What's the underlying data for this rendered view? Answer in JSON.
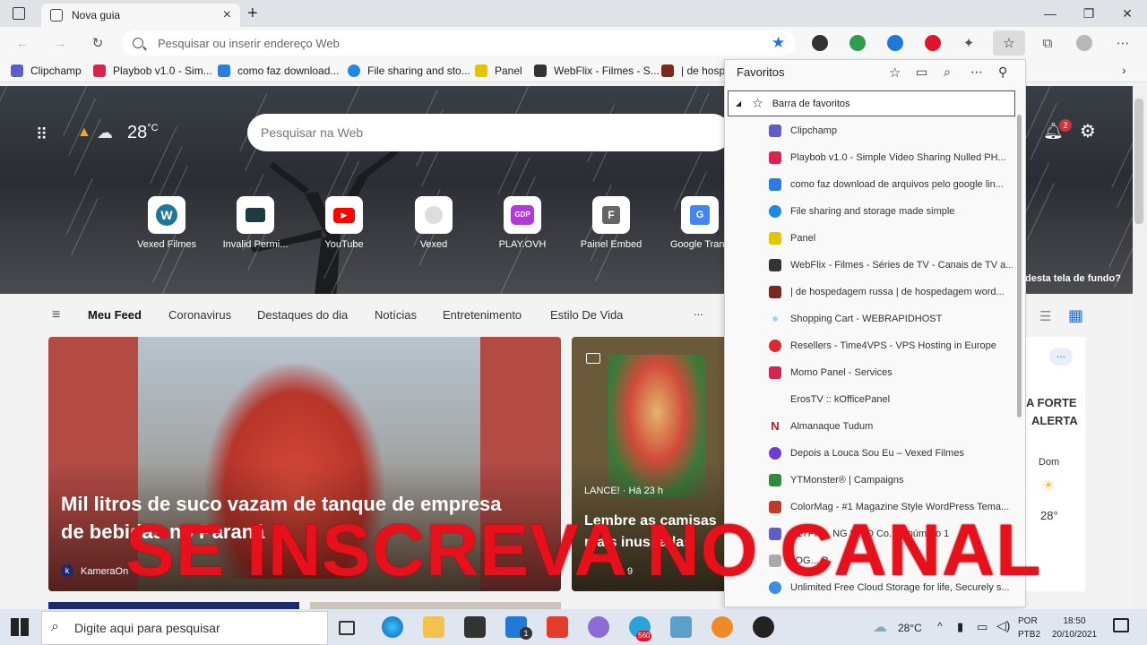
{
  "tab": {
    "title": "Nova guia"
  },
  "address": {
    "placeholder": "Pesquisar ou inserir endereço Web"
  },
  "bookmarks": [
    {
      "label": "Clipchamp",
      "color": "#5b5fc7"
    },
    {
      "label": "Playbob v1.0 - Sim...",
      "color": "#d6244c"
    },
    {
      "label": "como faz download...",
      "color": "#2a7de1"
    },
    {
      "label": "File sharing and sto...",
      "color": "#1e88e5"
    },
    {
      "label": "Panel",
      "color": "#e6c200"
    },
    {
      "label": "WebFlix - Filmes - S...",
      "color": "#333333"
    },
    {
      "label": "| de hospe",
      "color": "#7a2a1a"
    }
  ],
  "weather": {
    "temp": "28",
    "unit": "°C"
  },
  "websearch": {
    "placeholder": "Pesquisar na Web"
  },
  "notifications": {
    "count": "2"
  },
  "quicklinks": [
    {
      "label": "Vexed Filmes",
      "icon": "wordpress-icon"
    },
    {
      "label": "Invalid Permi...",
      "icon": "panel-icon"
    },
    {
      "label": "YouTube",
      "icon": "youtube-icon"
    },
    {
      "label": "Vexed",
      "icon": "circle-icon"
    },
    {
      "label": "PLAY.OVH",
      "icon": "gdp-icon"
    },
    {
      "label": "Painel Embed",
      "icon": "f-icon"
    },
    {
      "label": "Google Trans",
      "icon": "translate-icon"
    }
  ],
  "hero_question": "desta tela de fundo?",
  "feednav": {
    "items": [
      "Meu Feed",
      "Coronavirus",
      "Destaques do dia",
      "Notícias",
      "Entretenimento",
      "Estilo De Vida"
    ],
    "more": "..."
  },
  "card1": {
    "headline": "Mil litros de suco vazam de tanque de empresa de bebidas no Paraná",
    "source": "KameraOn"
  },
  "card2": {
    "source": "LANCE! · Há 23 h",
    "headline": "Lembre as camisas mais inusitadas",
    "count": "9"
  },
  "card3": {
    "line1": "A FORTE",
    "line2": "ALERTA",
    "day": "Dom",
    "temp": "28°",
    "more": "..."
  },
  "favorites": {
    "title": "Favoritos",
    "folder": "Barra de favoritos",
    "items": [
      {
        "label": "Clipchamp",
        "color": "#5b5fc7"
      },
      {
        "label": "Playbob v1.0 - Simple Video Sharing Nulled PH...",
        "color": "#d6244c"
      },
      {
        "label": "como faz download de arquivos pelo google lin...",
        "color": "#2a7de1"
      },
      {
        "label": "File sharing and storage made simple",
        "color": "#1e88e5"
      },
      {
        "label": "Panel",
        "color": "#e6c200"
      },
      {
        "label": "WebFlix - Filmes - Séries de TV - Canais de TV a...",
        "color": "#333333"
      },
      {
        "label": "| de hospedagem russa | de hospedagem word...",
        "color": "#7a2a1a"
      },
      {
        "label": "Shopping Cart - WEBRAPIDHOST",
        "color": "#9ad3ff"
      },
      {
        "label": "Resellers - Time4VPS - VPS Hosting in Europe",
        "color": "#e0262f"
      },
      {
        "label": "Momo Panel - Services",
        "color": "#d6244c"
      },
      {
        "label": "ErosTV :: kOfficePanel",
        "color": "#f9f9f9"
      },
      {
        "label": "Almanaque Tudum",
        "color": "#e50914"
      },
      {
        "label": "Depois a Louca Sou Eu – Vexed Filmes",
        "color": "#6b3fd6"
      },
      {
        "label": "YTMonster® | Campaigns",
        "color": "#2e8b3e"
      },
      {
        "label": "ColorMag - #1 Magazine Style WordPress Tema...",
        "color": "#c0392b"
      },
      {
        "label": "S17PR... NG L... D Co... y número 1",
        "color": "#5b5fc7"
      },
      {
        "label": "JOG... P",
        "color": "#aaaaaa"
      },
      {
        "label": "Unlimited Free Cloud Storage for life, Securely s...",
        "color": "#3a8ee6"
      }
    ]
  },
  "overlay_text": "SE INSCREVA NO CANAL",
  "taskbar": {
    "search_placeholder": "Digite aqui para pesquisar",
    "temp": "28°C",
    "lang1": "POR",
    "lang2": "PTB2",
    "time": "18:50",
    "date": "20/10/2021",
    "mail_badge": "1",
    "app_badge": "560"
  }
}
